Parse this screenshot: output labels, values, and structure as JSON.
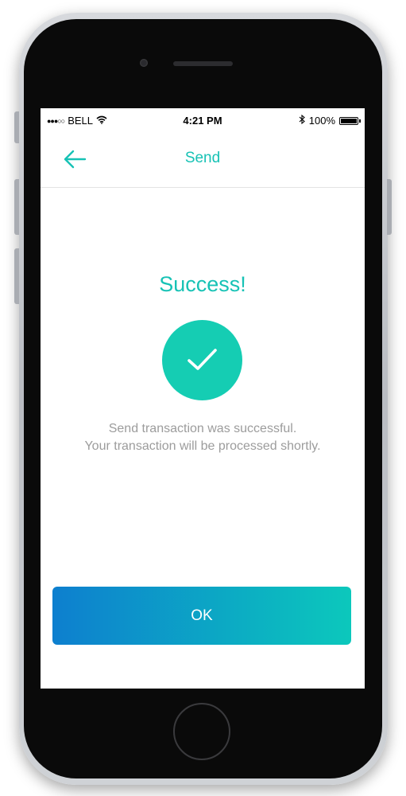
{
  "status_bar": {
    "signal": "●●●○○",
    "carrier": "BELL",
    "time": "4:21 PM",
    "battery_percent": "100%",
    "battery_level": 1.0
  },
  "nav": {
    "title": "Send",
    "back_icon": "arrow-left-icon"
  },
  "content": {
    "title": "Success!",
    "status_icon": "checkmark-icon",
    "message_line1": "Send transaction was successful.",
    "message_line2": "Your transaction will be processed shortly."
  },
  "actions": {
    "ok_label": "OK"
  },
  "colors": {
    "accent": "#17c2b5",
    "check_circle": "#15cdb3",
    "button_gradient_start": "#0d7fcf",
    "button_gradient_end": "#0cc8bc",
    "message_text": "#9c9c9c"
  }
}
